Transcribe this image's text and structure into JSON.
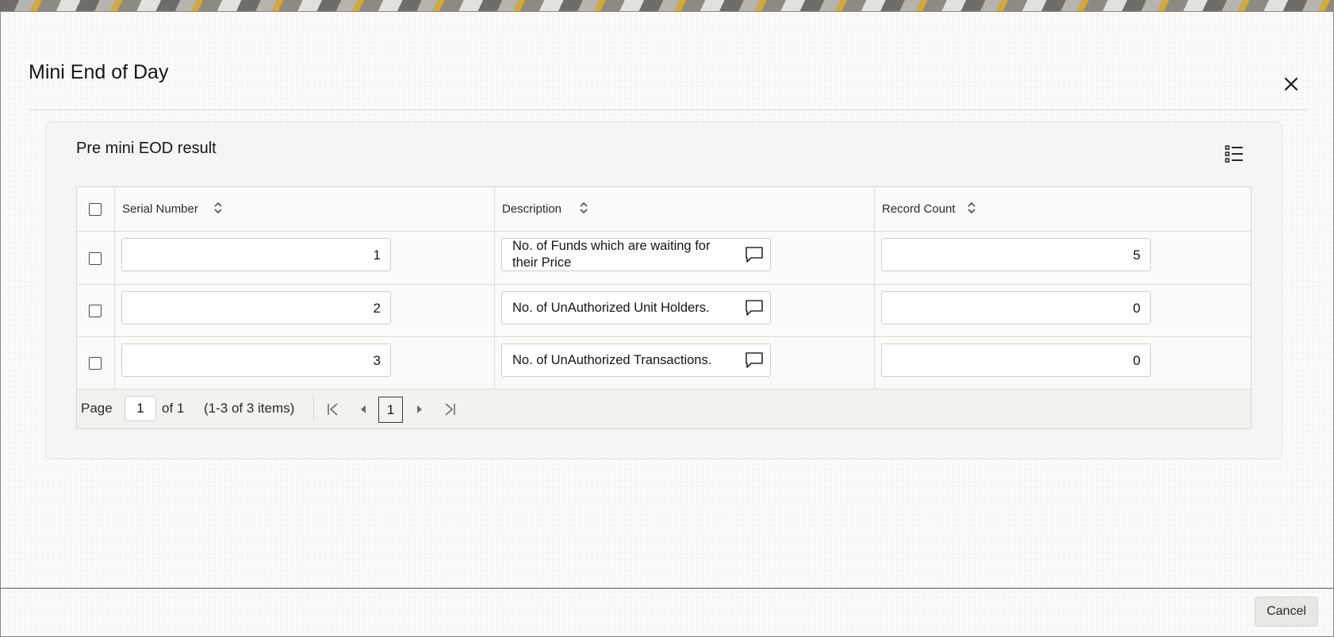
{
  "dialog": {
    "title": "Mini End of Day",
    "close_icon": "close-icon"
  },
  "panel": {
    "title": "Pre mini EOD result",
    "view_icon": "list-view-icon"
  },
  "table": {
    "columns": [
      {
        "label": "Serial Number"
      },
      {
        "label": "Description"
      },
      {
        "label": "Record Count"
      }
    ],
    "rows": [
      {
        "serial": "1",
        "description": "No. of Funds which are waiting for their Price",
        "count": "5"
      },
      {
        "serial": "2",
        "description": "No. of UnAuthorized Unit Holders.",
        "count": "0"
      },
      {
        "serial": "3",
        "description": "No. of UnAuthorized Transactions.",
        "count": "0"
      }
    ]
  },
  "pagination": {
    "page_label": "Page",
    "page_value": "1",
    "of_label": "of 1",
    "items_label": "(1-3 of 3 items)",
    "current_page": "1"
  },
  "footer": {
    "cancel_label": "Cancel"
  }
}
